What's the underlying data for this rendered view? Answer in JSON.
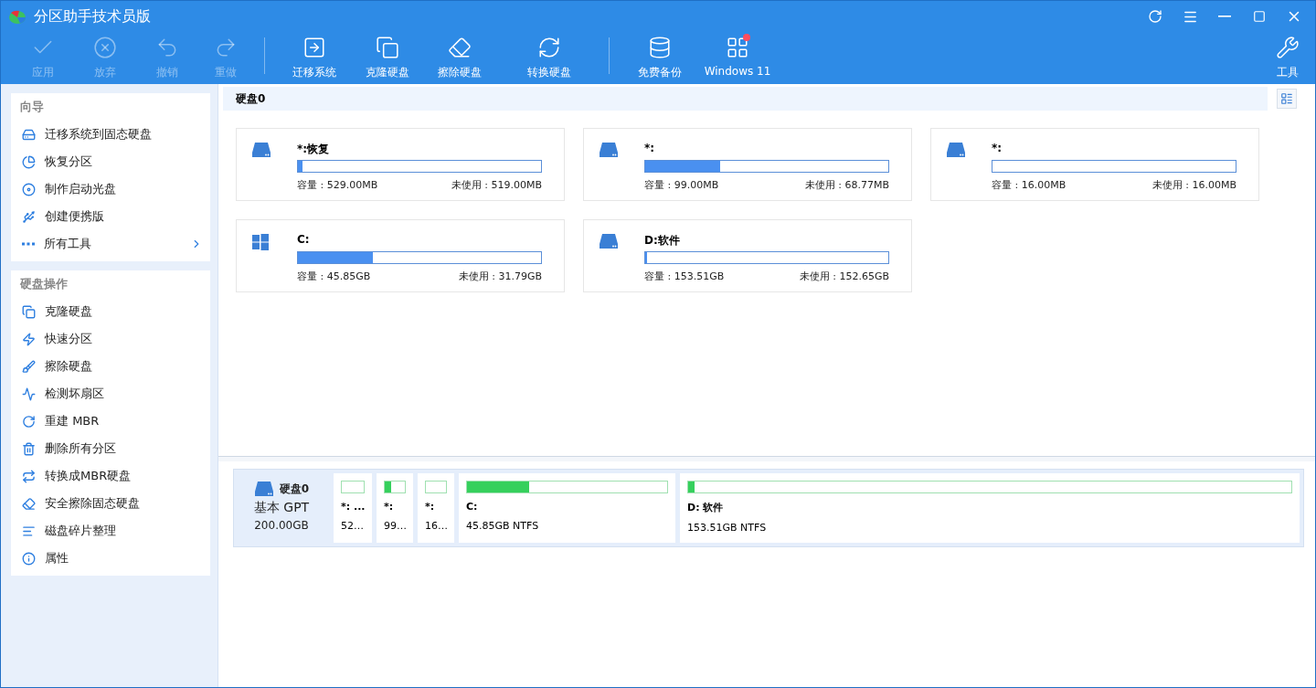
{
  "window": {
    "title": "分区助手技术员版"
  },
  "toolbar": [
    {
      "label": "应用",
      "disabled": true
    },
    {
      "label": "放弃",
      "disabled": true
    },
    {
      "label": "撤销",
      "disabled": true
    },
    {
      "label": "重做",
      "disabled": true
    },
    {
      "label": "迁移系统",
      "disabled": false
    },
    {
      "label": "克隆硬盘",
      "disabled": false
    },
    {
      "label": "擦除硬盘",
      "disabled": false
    },
    {
      "label": "转换硬盘",
      "disabled": false
    },
    {
      "label": "免费备份",
      "disabled": false
    },
    {
      "label": "Windows 11",
      "disabled": false,
      "badge": true
    },
    {
      "label": "工具",
      "disabled": false
    }
  ],
  "sidebar": [
    {
      "title": "向导",
      "items": [
        {
          "label": "迁移系统到固态硬盘",
          "submenu": false
        },
        {
          "label": "恢复分区",
          "submenu": false
        },
        {
          "label": "制作启动光盘",
          "submenu": false
        },
        {
          "label": "创建便携版",
          "submenu": false
        },
        {
          "label": "所有工具",
          "submenu": true
        }
      ]
    },
    {
      "title": "硬盘操作",
      "items": [
        {
          "label": "克隆硬盘",
          "submenu": false
        },
        {
          "label": "快速分区",
          "submenu": false
        },
        {
          "label": "擦除硬盘",
          "submenu": false
        },
        {
          "label": "检测坏扇区",
          "submenu": false
        },
        {
          "label": "重建 MBR",
          "submenu": false
        },
        {
          "label": "删除所有分区",
          "submenu": false
        },
        {
          "label": "转换成MBR硬盘",
          "submenu": false
        },
        {
          "label": "安全擦除固态硬盘",
          "submenu": false
        },
        {
          "label": "磁盘碎片整理",
          "submenu": false
        },
        {
          "label": "属性",
          "submenu": false
        }
      ]
    }
  ],
  "disk_header": "硬盘0",
  "partitions": [
    {
      "name": "*:恢复",
      "kind": "disk",
      "level": 0.02,
      "capacity": "容量 : 529.00MB",
      "unused": "未使用 : 519.00MB"
    },
    {
      "name": "*:",
      "kind": "disk",
      "level": 0.31,
      "capacity": "容量 : 99.00MB",
      "unused": "未使用 : 68.77MB"
    },
    {
      "name": "*:",
      "kind": "disk",
      "level": 0,
      "capacity": "容量 : 16.00MB",
      "unused": "未使用 : 16.00MB"
    },
    {
      "name": "C:",
      "kind": "windows",
      "level": 0.31,
      "capacity": "容量 : 45.85GB",
      "unused": "未使用 : 31.79GB"
    },
    {
      "name": "D:软件",
      "kind": "disk",
      "level": 0.006,
      "capacity": "容量 : 153.51GB",
      "unused": "未使用 : 152.65GB"
    }
  ],
  "disk_map": {
    "name": "硬盘0",
    "type": "基本 GPT",
    "size": "200.00GB",
    "partitions": [
      {
        "name": "*: ...",
        "info": "52…",
        "level": 0
      },
      {
        "name": "*:",
        "info": "99…",
        "level": 0.33
      },
      {
        "name": "*:",
        "info": "16…",
        "level": 0
      },
      {
        "name": "C:",
        "info": "45.85GB NTFS",
        "level": 0.31
      },
      {
        "name": "D: 软件",
        "info": "153.51GB NTFS",
        "level": 0.01
      }
    ]
  }
}
